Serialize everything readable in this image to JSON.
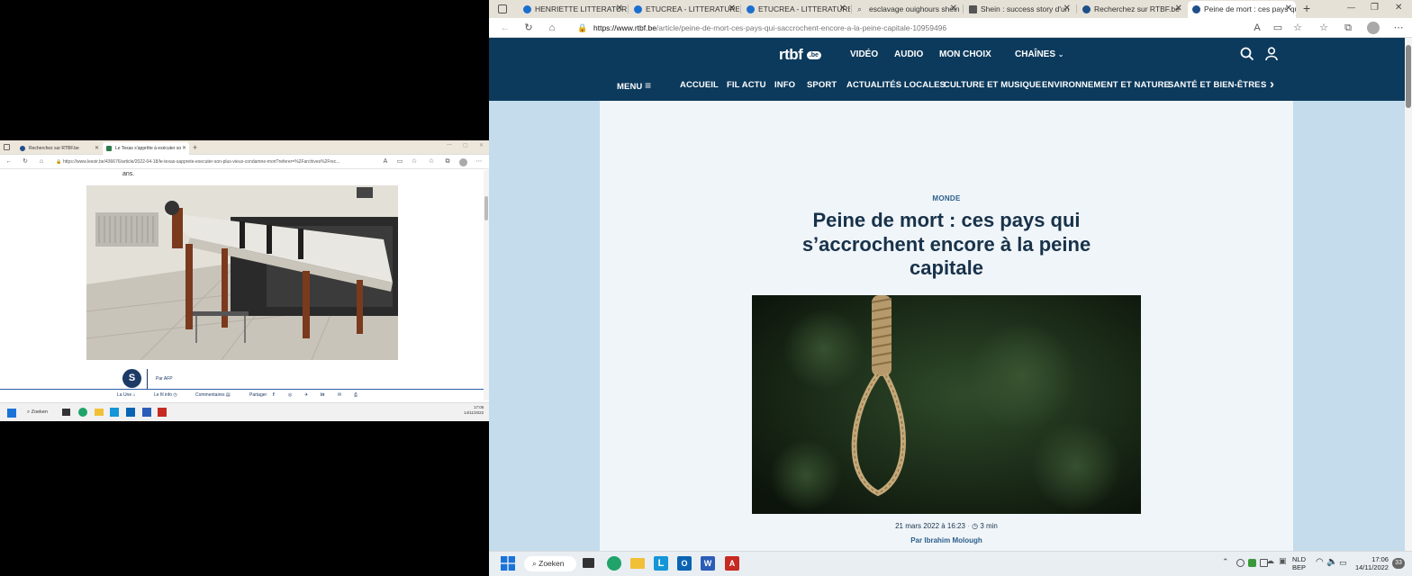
{
  "left_window": {
    "tabs": [
      {
        "label": "Recherchez sur RTBF.be"
      },
      {
        "label": "Le Texas s'apprête à exécuter so"
      }
    ],
    "url": "https://www.lesoir.be/436676/article/2022-04-18/le-texas-sapprete-executer-son-plus-vieux-condamne-mort?referer=%2Farchives%2Frec...",
    "article_tail": "ans.",
    "author_initial": "S",
    "author_text": "Par AFP",
    "share_links": {
      "la_une": "La Une",
      "fil_info": "Le fil info",
      "comments": "Commentaires",
      "share": "Partager"
    },
    "taskbar": {
      "search": "Zoeken",
      "time": "17:06",
      "date": "14/11/2022"
    }
  },
  "right_window": {
    "tabs": [
      {
        "label": "HENRIETTE LITTERATURE"
      },
      {
        "label": "ETUCREA - LITTERATURE"
      },
      {
        "label": "ETUCREA - LITTERATURE"
      },
      {
        "label": "esclavage ouighours shein"
      },
      {
        "label": "Shein : success story d'un"
      },
      {
        "label": "Recherchez sur RTBF.be"
      },
      {
        "label": "Peine de mort : ces pays qu"
      }
    ],
    "url_host": "https://www.rtbf.be",
    "url_path": "/article/peine-de-mort-ces-pays-qui-saccrochent-encore-a-la-peine-capitale-10959496",
    "site": {
      "logo": "rtbf",
      "logo_badge": ".be",
      "top_nav": [
        "VIDÉO",
        "AUDIO",
        "MON CHOIX",
        "CHAÎNES"
      ],
      "menu_label": "MENU",
      "main_nav": [
        "ACCUEIL",
        "FIL ACTU",
        "INFO",
        "SPORT",
        "ACTUALITÉS LOCALES",
        "CULTURE ET MUSIQUE",
        "ENVIRONNEMENT ET NATURE",
        "SANTÉ ET BIEN-ÊTRE",
        "S"
      ]
    },
    "article": {
      "category": "MONDE",
      "title_line1": "Peine de mort : ces pays qui",
      "title_line2": "s’accrochent encore à la peine",
      "title_line3": "capitale",
      "date": "21 mars 2022 à 16:23",
      "read_time": "3 min",
      "author": "Par Ibrahim Molough"
    }
  },
  "taskbar": {
    "search": "Zoeken",
    "lang1": "NLD",
    "lang2": "BEP",
    "time": "17:06",
    "date": "14/11/2022",
    "notif_count": "33"
  },
  "colors": {
    "rtbf_navy": "#0c3a5c",
    "page_light_blue": "#c4dceb",
    "card_bg": "#f0f5f9",
    "category_blue": "#2b5f8a",
    "headline": "#18324a"
  }
}
